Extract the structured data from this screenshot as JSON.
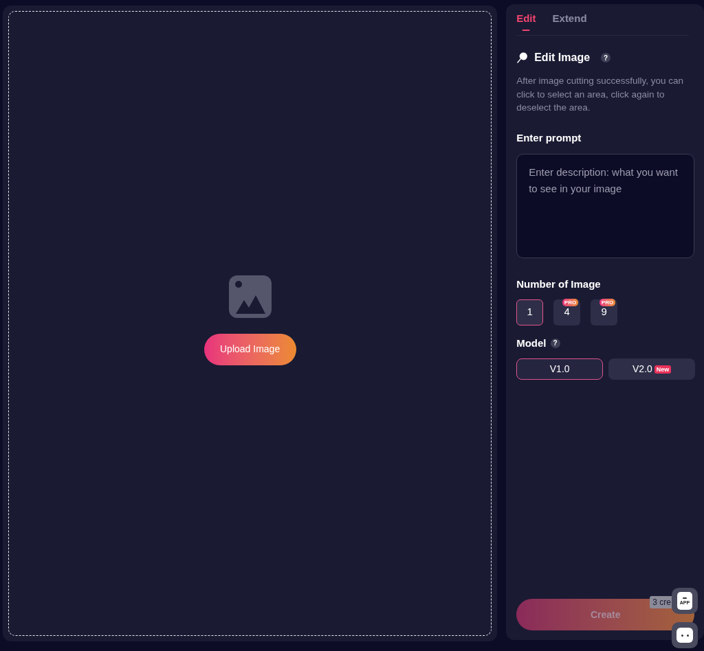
{
  "upload": {
    "button": "Upload Image"
  },
  "tabs": [
    {
      "label": "Edit",
      "selected": true
    },
    {
      "label": "Extend",
      "selected": false
    }
  ],
  "section": {
    "title": "Edit Image",
    "help": "?",
    "description": "After image cutting successfully, you can click to select an area, click again to deselect the area."
  },
  "prompt": {
    "label": "Enter prompt",
    "placeholder": "Enter description: what you want to see in your image"
  },
  "number_of_image": {
    "label": "Number of Image",
    "options": [
      {
        "label": "1",
        "selected": true
      },
      {
        "label": "4",
        "badge": "PRO",
        "selected": false
      },
      {
        "label": "9",
        "badge": "PRO",
        "selected": false
      }
    ]
  },
  "model": {
    "label": "Model",
    "help": "?",
    "options": [
      {
        "label": "V1.0",
        "selected": true
      },
      {
        "label": "V2.0",
        "badge": "New",
        "selected": false
      }
    ]
  },
  "create": {
    "label": "Create",
    "credits": "3 cre"
  },
  "floating": [
    {
      "kind": "app",
      "label": "APP"
    },
    {
      "kind": "chat"
    }
  ]
}
